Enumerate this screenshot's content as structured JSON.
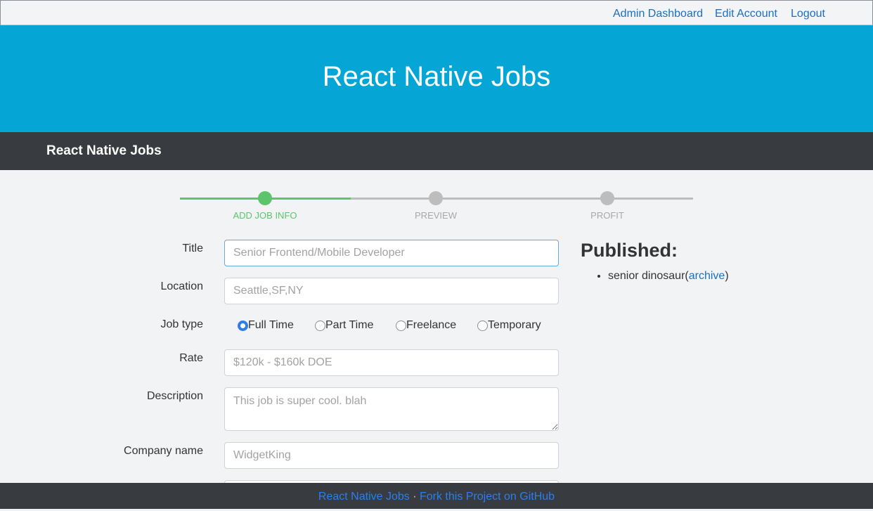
{
  "topnav": {
    "links": [
      "Admin Dashboard",
      "Edit Account",
      "Logout"
    ]
  },
  "hero": {
    "title": "React Native Jobs"
  },
  "brandbar": {
    "brand": "React Native Jobs"
  },
  "stepper": {
    "steps": [
      "ADD JOB INFO",
      "PREVIEW",
      "PROFIT"
    ],
    "active_step": 0,
    "colors": {
      "done": "#5cc56b",
      "pending": "#bdbdbd"
    }
  },
  "form": {
    "title": {
      "label": "Title",
      "placeholder": "Senior Frontend/Mobile Developer"
    },
    "location": {
      "label": "Location",
      "placeholder": "Seattle,SF,NY"
    },
    "job_type": {
      "label": "Job type",
      "options": [
        "Full Time",
        "Part Time",
        "Freelance",
        "Temporary"
      ],
      "selected": "Full Time"
    },
    "rate": {
      "label": "Rate",
      "placeholder": "$120k - $160k DOE"
    },
    "description": {
      "label": "Description",
      "placeholder": "This job is super cool. blah"
    },
    "company_name": {
      "label": "Company name",
      "placeholder": "WidgetKing"
    }
  },
  "published": {
    "heading": "Published:",
    "items": [
      {
        "name": "senior dinosaur",
        "open": "(",
        "link": "archive",
        "close": ")"
      }
    ]
  },
  "footer": {
    "link1": "React Native Jobs",
    "separator": " · ",
    "link2": "Fork this Project on GitHub"
  },
  "colors": {
    "hero_bg": "#05a5d6",
    "navbar_bg": "#383b3f",
    "link": "#1a6fc4",
    "radio_checked": "#2f7ee5"
  }
}
